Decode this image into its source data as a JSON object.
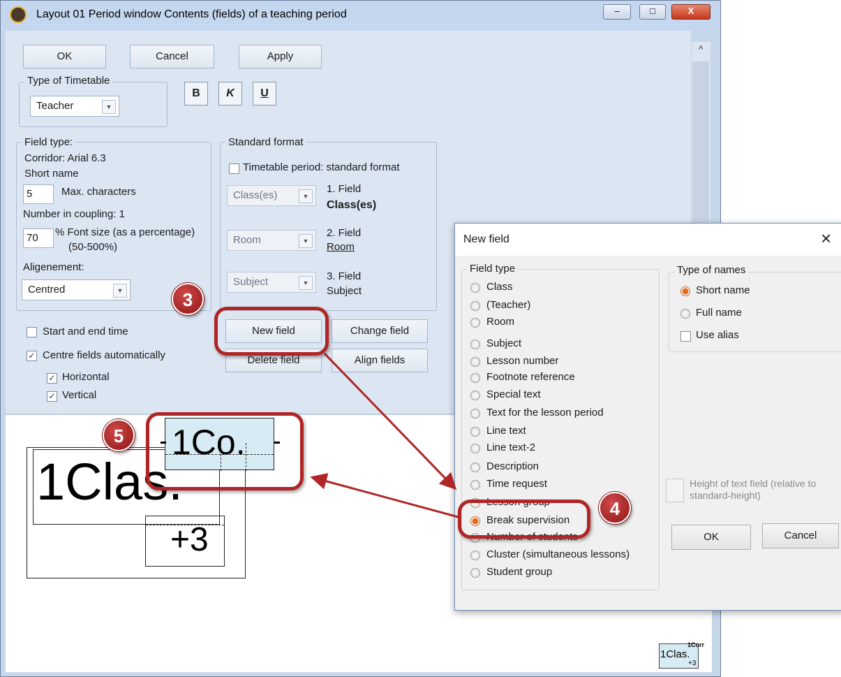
{
  "window": {
    "title": "Layout 01  Period window  Contents (fields) of a teaching period",
    "minimize": "–",
    "maximize": "□",
    "close": "X"
  },
  "toolbar": {
    "ok": "OK",
    "cancel": "Cancel",
    "apply": "Apply"
  },
  "timetable_type": {
    "group": "Type of Timetable",
    "value": "Teacher"
  },
  "format": {
    "bold": "B",
    "italic": "K",
    "underline": "U"
  },
  "field_type_group": {
    "title": "Field type:",
    "line1": "Corridor: Arial 6.3",
    "line2": "Short name",
    "max_chars_value": "5",
    "max_chars_label": "Max. characters",
    "coupling": "Number in coupling: 1",
    "font_size_value": "70",
    "font_size_label": "% Font size (as a percentage)",
    "font_size_range": "(50-500%)",
    "alignment_label": "Aligenement:",
    "alignment_value": "Centred"
  },
  "standard_format": {
    "title": "Standard format",
    "checkbox": "Timetable period: standard format",
    "field1_combo": "Class(es)",
    "field1_label": "1. Field",
    "field1_value": "Class(es)",
    "field2_combo": "Room",
    "field2_label": "2. Field",
    "field2_value": "Room",
    "field3_combo": "Subject",
    "field3_label": "3. Field",
    "field3_value": "Subject"
  },
  "options": {
    "start_end": "Start and end time",
    "centre_auto": "Centre fields automatically",
    "horizontal": "Horizontal",
    "vertical": "Vertical",
    "check_mark": "✓"
  },
  "field_buttons": {
    "new_field": "New field",
    "change_field": "Change field",
    "delete_field": "Delete field",
    "align_fields": "Align fields"
  },
  "preview": {
    "corridor_text": "1Co.",
    "class_text": "1Clas.",
    "count_text": "+3",
    "thumb_corridor": "1Corr",
    "thumb_class": "1Clas.",
    "thumb_count": "+3"
  },
  "callouts": {
    "step3": "3",
    "step4": "4",
    "step5": "5"
  },
  "dialog": {
    "title": "New field",
    "close": "×",
    "field_type_group": "Field type",
    "field_types": [
      "Class",
      "(Teacher)",
      "Room",
      "Subject",
      "Lesson number",
      "Footnote reference",
      "Special text",
      "Text for the lesson period",
      "Line text",
      "Line text-2",
      "Description",
      "Time request",
      "Lesson group",
      "Break supervision",
      "Number of students",
      "Cluster (simultaneous lessons)",
      "Student group"
    ],
    "selected_field_type": "Break supervision",
    "names_group": "Type of names",
    "short_name": "Short name",
    "full_name": "Full name",
    "use_alias": "Use alias",
    "height_label": "Height of text field (relative to standard-height)",
    "ok": "OK",
    "cancel": "Cancel"
  },
  "colors": {
    "callout": "#b02525",
    "window_bg": "#dce6f3",
    "selected_radio": "#e86a1e"
  }
}
